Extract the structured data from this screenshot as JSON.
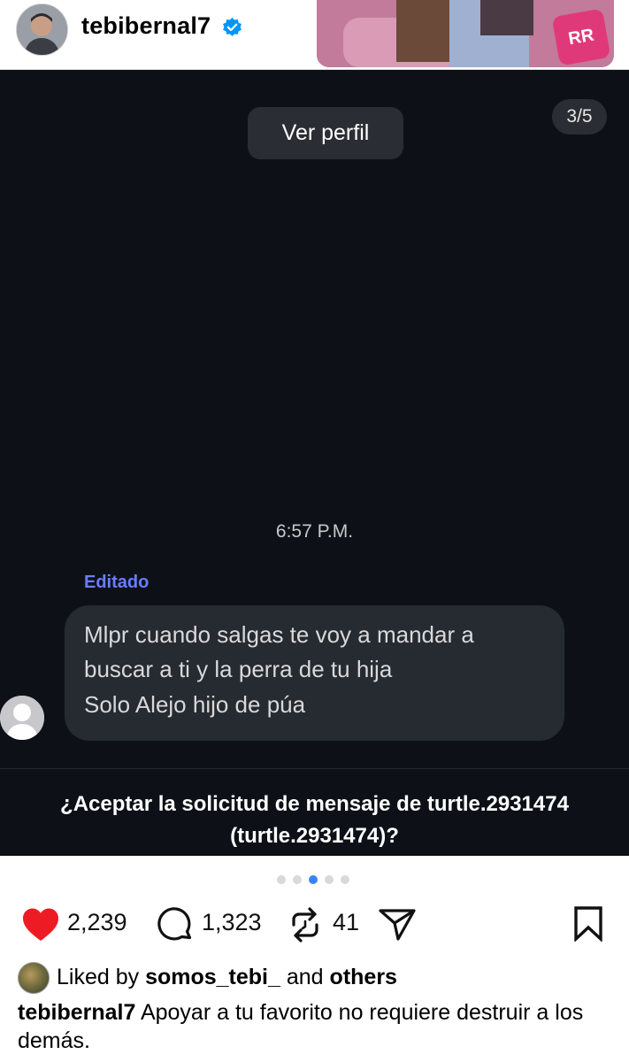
{
  "header": {
    "username": "tebibernal7",
    "thumb_badge": "RR"
  },
  "dm": {
    "view_profile": "Ver perfil",
    "counter": "3/5",
    "time": "6:57 P.M.",
    "edited": "Editado",
    "message_lines": [
      "Mlpr cuando salgas te voy a mandar a",
      "buscar a ti y la perra de tu hija",
      "Solo Alejo hijo de púa"
    ],
    "request_line1": "¿Aceptar la solicitud de mensaje de turtle.2931474",
    "request_line2": "(turtle.2931474)?"
  },
  "carousel": {
    "total": 5,
    "active_index": 2
  },
  "actions": {
    "likes": "2,239",
    "comments": "1,323",
    "reposts": "41"
  },
  "liked_by": {
    "prefix": "Liked by",
    "user": "somos_tebi_",
    "middle": "and",
    "others": "others"
  },
  "caption": {
    "username": "tebibernal7",
    "text": "Apoyar a tu favorito no requiere destruir a los demás."
  },
  "colors": {
    "dark_bg": "#0d1117",
    "bubble": "#262a31",
    "edited": "#6a7dff",
    "verified": "#0095f6",
    "heart": "#ed1c24",
    "dot_active": "#3b82f6"
  },
  "icons": [
    "verified-badge-icon",
    "heart-icon",
    "comment-icon",
    "repost-icon",
    "share-icon",
    "bookmark-icon",
    "default-avatar-icon"
  ]
}
